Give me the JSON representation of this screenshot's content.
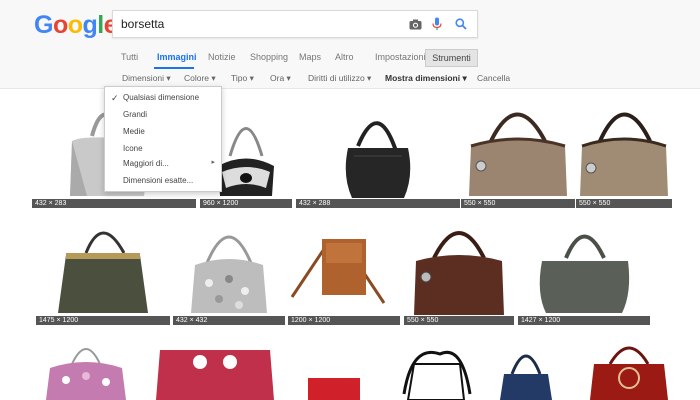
{
  "search": {
    "query": "borsetta"
  },
  "logo": {
    "text": "Google"
  },
  "tabs": [
    {
      "label": "Tutti"
    },
    {
      "label": "Immagini"
    },
    {
      "label": "Notizie"
    },
    {
      "label": "Shopping"
    },
    {
      "label": "Maps"
    },
    {
      "label": "Altro"
    },
    {
      "label": "Impostazioni"
    }
  ],
  "tools_label": "Strumenti",
  "filters": [
    {
      "label": "Dimensioni ▾"
    },
    {
      "label": "Colore ▾"
    },
    {
      "label": "Tipo ▾"
    },
    {
      "label": "Ora ▾"
    },
    {
      "label": "Diritti di utilizzo ▾"
    },
    {
      "label": "Mostra dimensioni ▾"
    },
    {
      "label": "Cancella"
    }
  ],
  "size_menu": {
    "items": [
      {
        "label": "Qualsiasi dimensione",
        "selected": true
      },
      {
        "label": "Grandi"
      },
      {
        "label": "Medie"
      },
      {
        "label": "Icone"
      },
      {
        "label": "Maggiori di..."
      },
      {
        "label": "Dimensioni esatte..."
      }
    ]
  },
  "results": [
    {
      "caption": "432 × 283"
    },
    {
      "caption": "960 × 1200"
    },
    {
      "caption": "432 × 288"
    },
    {
      "caption": "550 × 550"
    },
    {
      "caption": "550 × 550"
    },
    {
      "caption": "1475 × 1200"
    },
    {
      "caption": "432 × 432"
    },
    {
      "caption": "1200 × 1200"
    },
    {
      "caption": "550 × 550"
    },
    {
      "caption": "1427 × 1200"
    },
    {
      "caption": ""
    },
    {
      "caption": ""
    },
    {
      "caption": ""
    },
    {
      "caption": ""
    },
    {
      "caption": ""
    },
    {
      "caption": ""
    }
  ],
  "colors": {
    "accent": "#1a73e8",
    "logo_blue": "#4285F4",
    "logo_red": "#EA4335",
    "logo_yellow": "#FBBC05",
    "logo_green": "#34A853"
  }
}
